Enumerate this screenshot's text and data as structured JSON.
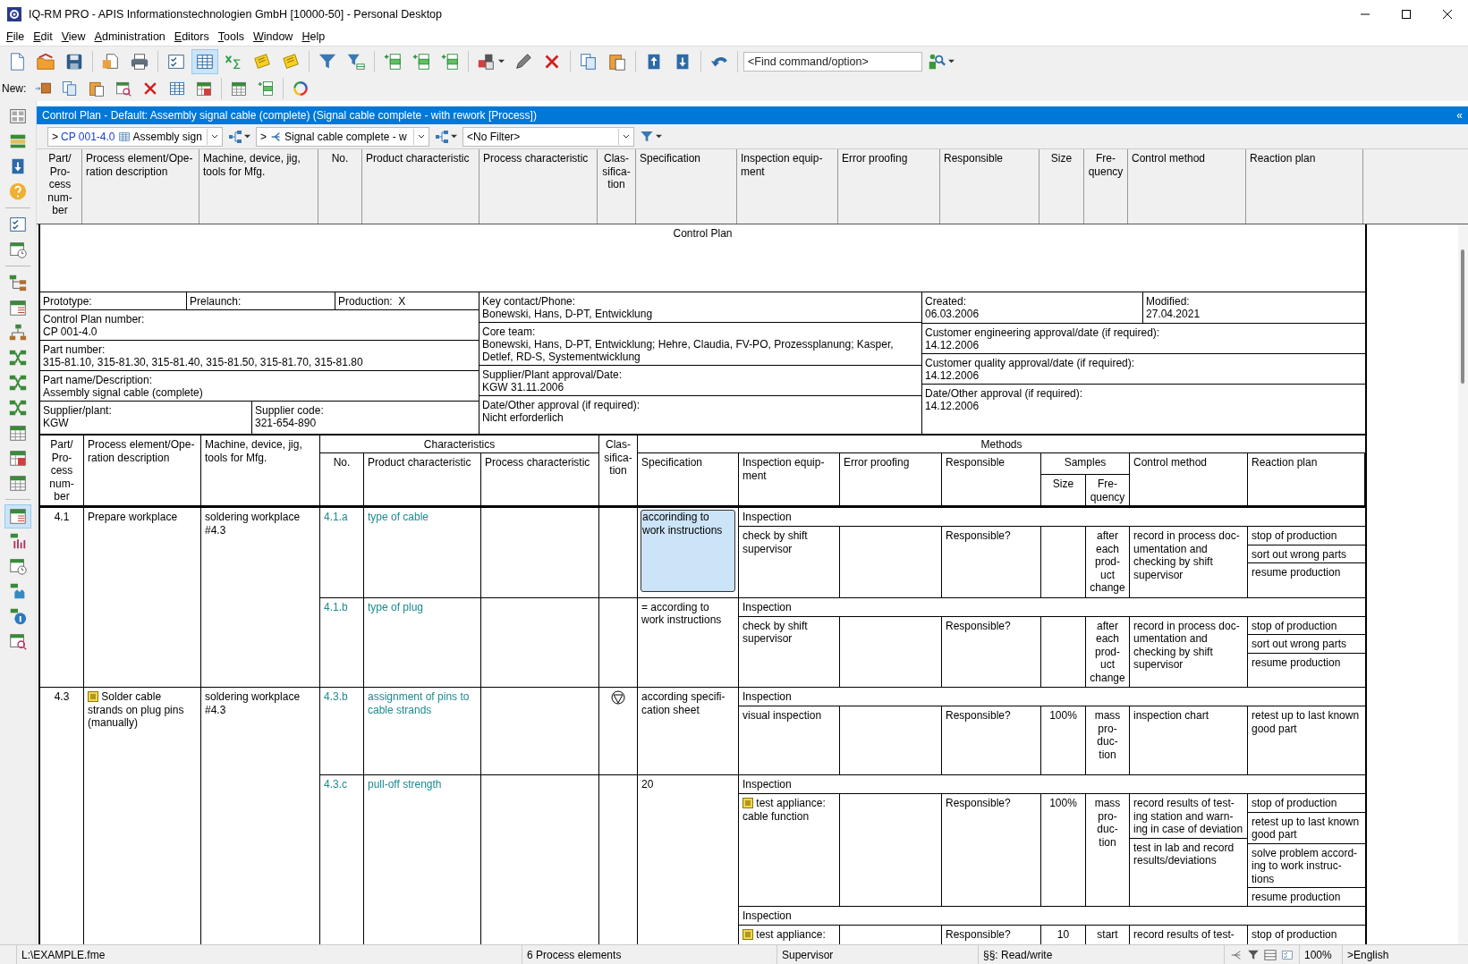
{
  "window": {
    "title": "IQ-RM PRO  - APIS Informationstechnologien GmbH [10000-50] - Personal Desktop"
  },
  "menu": [
    "File",
    "Edit",
    "View",
    "Administration",
    "Editors",
    "Tools",
    "Window",
    "Help"
  ],
  "toolbar": {
    "find_placeholder": "<Find command/option>",
    "new_label": "New:"
  },
  "panel": {
    "title": "Control Plan - Default: Assembly signal cable (complete) (Signal cable complete - with rework [Process])",
    "collapse": "«"
  },
  "selectors": [
    {
      "prefix": ">",
      "code": "CP 001-4.0",
      "text": "Assembly sign"
    },
    {
      "prefix": ">",
      "text": "Signal cable complete - w"
    }
  ],
  "filter": {
    "value": "<No Filter>"
  },
  "columns": [
    "Part/\nPro-\ncess\nnum-\nber",
    "Process element/Ope-\nration description",
    "Machine, device, jig,\ntools for Mfg.",
    "No.",
    "Product characteristic",
    "Process characteristic",
    "Clas-\nsifica-\ntion",
    "Specification",
    "Inspection equip-\nment",
    "Error proofing",
    "Responsible",
    "Size",
    "Fre-\nquency",
    "Control method",
    "Reaction plan"
  ],
  "form": {
    "title": "Control Plan",
    "phases": [
      {
        "label": "Prototype:"
      },
      {
        "label": "Prelaunch:"
      },
      {
        "label": "Production:",
        "value": "X"
      }
    ],
    "left": [
      {
        "label": "Control Plan number:",
        "value": "CP 001-4.0"
      },
      {
        "label": "Part number:",
        "value": "315-81.10, 315-81.30, 315-81.40, 315-81.50, 315-81.70, 315-81.80"
      },
      {
        "label": "Part name/Description:",
        "value": "Assembly signal cable (complete)"
      }
    ],
    "supplier": [
      {
        "label": "Supplier/plant:",
        "value": "KGW"
      },
      {
        "label": "Supplier code:",
        "value": "321-654-890"
      }
    ],
    "middle": [
      {
        "label": "Key contact/Phone:",
        "value": "Bonewski, Hans, D-PT, Entwicklung"
      },
      {
        "label": "Core team:",
        "value": "Bonewski, Hans, D-PT, Entwicklung; Hehre, Claudia, FV-PO, Prozessplanung; Kasper, Detlef, RD-S, Systementwicklung"
      },
      {
        "label": "Supplier/Plant approval/Date:",
        "value": "KGW 31.11.2006"
      },
      {
        "label": "Date/Other approval (if required):",
        "value": "Nicht erforderlich"
      }
    ],
    "dates": [
      {
        "label": "Created:",
        "value": "06.03.2006"
      },
      {
        "label": "Modified:",
        "value": "27.04.2021"
      }
    ],
    "right": [
      {
        "label": "Customer engineering approval/date (if required):",
        "value": "14.12.2006"
      },
      {
        "label": "Customer quality approval/date (if required):",
        "value": "14.12.2006"
      },
      {
        "label": "Date/Other approval (if required):",
        "value": "14.12.2006"
      }
    ]
  },
  "doc_header": {
    "groups": [
      "Characteristics",
      "Methods",
      "Samples"
    ],
    "columns": [
      "Part/\nPro-\ncess\nnum-\nber",
      "Process element/Ope-\nration description",
      "Machine, device, jig,\ntools for Mfg.",
      "No.",
      "Product characteristic",
      "Process characteristic",
      "Clas-\nsifica-\ntion",
      "Specification",
      "Inspection equip-\nment",
      "Error proofing",
      "Responsible",
      "Size",
      "Fre-\nquency",
      "Control method",
      "Reaction plan"
    ]
  },
  "processes": [
    {
      "number": "4.1",
      "name": "Prepare workplace",
      "note": false,
      "machine": "soldering workplace #4.3",
      "characteristics": [
        {
          "no": "4.1.a",
          "product": "type of cable",
          "special": false,
          "spec": "accorinding to work instructions",
          "selected": true,
          "methods": [
            {
              "title": "Inspection",
              "equipment": "check by shift supervisor",
              "note": false,
              "responsible": "Responsible?",
              "frequency": "after\neach\nprod-\nuct\nchange",
              "controls": [
                "record in process doc-\numentation and\nchecking by shift\nsupervisor"
              ],
              "reactions": [
                "stop of production",
                "sort out wrong parts",
                "resume production"
              ]
            }
          ]
        },
        {
          "no": "4.1.b",
          "product": "type of plug",
          "special": false,
          "spec": "= according to work instructions",
          "selected": false,
          "methods": [
            {
              "title": "Inspection",
              "equipment": "check by shift supervisor",
              "note": false,
              "responsible": "Responsible?",
              "frequency": "after\neach\nprod-\nuct\nchange",
              "controls": [
                "record in process doc-\numentation and\nchecking by shift\nsupervisor"
              ],
              "reactions": [
                "stop of production",
                "sort out wrong parts",
                "resume production"
              ]
            }
          ]
        }
      ]
    },
    {
      "number": "4.3",
      "name": "Solder cable strands on plug pins (manually)",
      "note": true,
      "machine": "soldering workplace #4.3",
      "characteristics": [
        {
          "no": "4.3.b",
          "product": "assignment of pins to cable strands",
          "special": true,
          "spec": "according specifi-\ncation sheet",
          "selected": false,
          "methods": [
            {
              "title": "Inspection",
              "equipment": "visual inspection",
              "note": false,
              "responsible": "Responsible?",
              "size": "100%",
              "frequency": "mass\npro-\nduc-\ntion",
              "controls": [
                "inspection chart"
              ],
              "reactions": [
                "retest up to last known good part"
              ]
            }
          ]
        },
        {
          "no": "4.3.c",
          "product": "pull-off strength",
          "special": false,
          "spec": "20",
          "selected": false,
          "methods": [
            {
              "title": "Inspection",
              "equipment": "test appliance: cable function",
              "note": true,
              "responsible": "Responsible?",
              "size": "100%",
              "frequency": "mass\npro-\nduc-\ntion",
              "controls": [
                "record results of test-\ning station and warn-\ning in case of deviation",
                "test in lab and record results/deviations"
              ],
              "reactions": [
                "stop of production",
                "retest up to last known good part",
                "solve problem accord-\ning to work instruc-\ntions",
                "resume production"
              ]
            },
            {
              "title": "Inspection",
              "equipment": "test appliance:",
              "note": true,
              "responsible": "Responsible?",
              "size": "10",
              "frequency": "start",
              "controls": [
                "record results of test-"
              ],
              "reactions": [
                "stop of production"
              ]
            }
          ]
        }
      ]
    }
  ],
  "status_bar": {
    "file": "L:\\EXAMPLE.fme",
    "count": "6 Process elements",
    "role": "Supervisor",
    "access": "§§: Read/write",
    "zoom": "100%",
    "language": ">English"
  }
}
